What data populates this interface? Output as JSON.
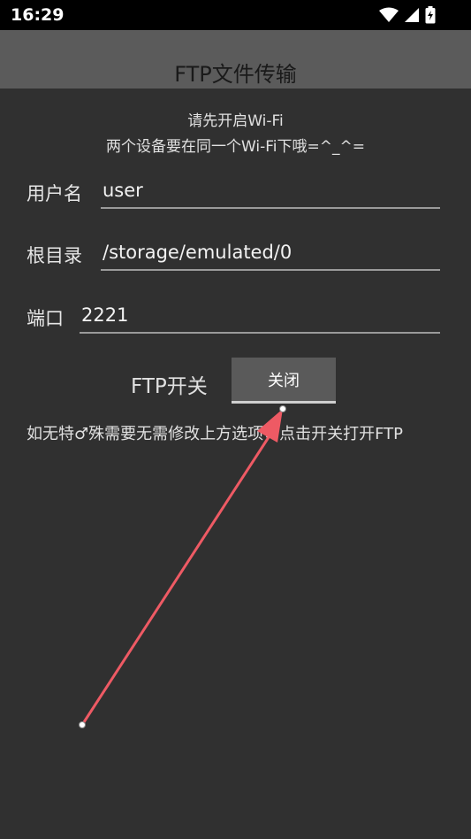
{
  "status_bar": {
    "time": "16:29"
  },
  "app": {
    "title": "FTP文件传输"
  },
  "hints": {
    "line1": "请先开启Wi-Fi",
    "line2": "两个设备要在同一个Wi-Fi下哦=^_^="
  },
  "form": {
    "username": {
      "label": "用户名",
      "value": "user"
    },
    "root_dir": {
      "label": "根目录",
      "value": "/storage/emulated/0"
    },
    "port": {
      "label": "端口",
      "value": "2221"
    }
  },
  "ftp_switch": {
    "label": "FTP开关",
    "button_label": "关闭"
  },
  "note": "如无特♂殊需要无需修改上方选项，点击开关打开FTP",
  "colors": {
    "background": "#303030",
    "title_bar": "#5b5b5b",
    "button": "#5a5a5a",
    "arrow": "#ee5a64"
  }
}
